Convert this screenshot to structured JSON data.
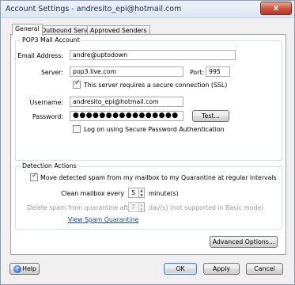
{
  "window": {
    "title": "Account Settings - andresito_epi@hotmail.com",
    "close_glyph": "x"
  },
  "tabs": [
    {
      "label": "General",
      "active": true
    },
    {
      "label": "Outbound Server",
      "active": false
    },
    {
      "label": "Approved Senders",
      "active": false
    }
  ],
  "pop3": {
    "legend": "POP3 Mail Account",
    "email_label": "Email Address:",
    "email_value": "andre@uptodown",
    "server_label": "Server:",
    "server_value": "pop3.live.com",
    "port_label": "Port:",
    "port_value": "995",
    "ssl_label": "This server requires a secure connection (SSL)",
    "ssl_checked": true,
    "username_label": "Username:",
    "username_value": "andresito_epi@hotmail.com",
    "password_label": "Password:",
    "password_value": "●●●●●●●●●●●●●●●●",
    "test_button": "Test...",
    "spa_label": "Log on using Secure Password Authentication",
    "spa_checked": false
  },
  "detection": {
    "legend": "Detection Actions",
    "move_label": "Move detected spam from my mailbox to my Quarantine at regular intervals",
    "move_checked": true,
    "clean_label": "Clean mailbox every",
    "clean_value": "5",
    "clean_unit": "minute(s)",
    "delete_label": "Delete spam from quarantine after",
    "delete_value": "7",
    "delete_unit": "day(s) (not supported in Basic mode)",
    "view_link": "View Spam Quarantine"
  },
  "advanced_button": "Advanced Options...",
  "footer": {
    "help": "Help",
    "ok": "OK",
    "apply": "Apply",
    "cancel": "Cancel",
    "help_icon_glyph": "?"
  }
}
